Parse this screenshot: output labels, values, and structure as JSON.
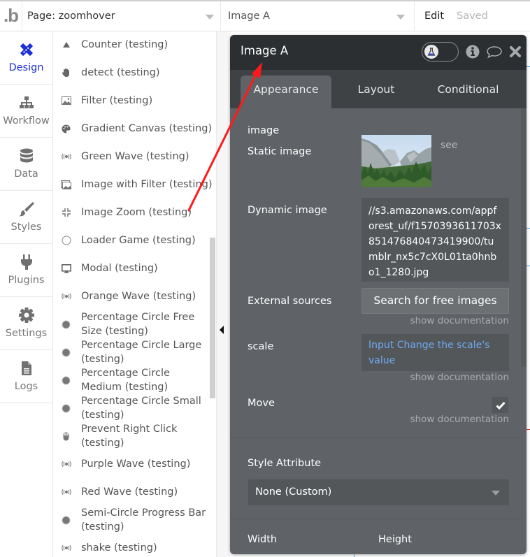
{
  "topbar": {
    "logo": ".b",
    "page_select": "Page: zoomhover",
    "element_select": "Image A",
    "edit_label": "Edit",
    "saved_label": "Saved"
  },
  "leftnav": {
    "items": [
      {
        "label": "Design",
        "icon": "design-icon",
        "active": true
      },
      {
        "label": "Workflow",
        "icon": "workflow-icon"
      },
      {
        "label": "Data",
        "icon": "database-icon"
      },
      {
        "label": "Styles",
        "icon": "brush-icon"
      },
      {
        "label": "Plugins",
        "icon": "plug-icon"
      },
      {
        "label": "Settings",
        "icon": "gear-icon"
      },
      {
        "label": "Logs",
        "icon": "document-icon"
      }
    ],
    "active_color": "#1c2fd6"
  },
  "element_list": {
    "items": [
      {
        "label": "Counter (testing)",
        "icon": "triangle-up-icon"
      },
      {
        "label": "detect (testing)",
        "icon": "hand-icon"
      },
      {
        "label": "Filter (testing)",
        "icon": "picture-icon"
      },
      {
        "label": "Gradient Canvas (testing)",
        "icon": "palette-icon"
      },
      {
        "label": "Green Wave (testing)",
        "icon": "broadcast-icon"
      },
      {
        "label": "Image with Filter (testing)",
        "icon": "pictures-icon"
      },
      {
        "label": "Image Zoom (testing)",
        "icon": "compress-icon"
      },
      {
        "label": "Loader Game (testing)",
        "icon": "circle-outline-icon"
      },
      {
        "label": "Modal (testing)",
        "icon": "monitor-icon"
      },
      {
        "label": "Orange Wave (testing)",
        "icon": "broadcast-icon"
      },
      {
        "label": "Percentage Circle Free Size (testing)",
        "icon": "circle-filled-icon"
      },
      {
        "label": "Percentage Circle Large (testing)",
        "icon": "circle-filled-icon"
      },
      {
        "label": "Percentage Circle Medium (testing)",
        "icon": "circle-filled-icon"
      },
      {
        "label": "Percentage Circle Small (testing)",
        "icon": "circle-filled-icon"
      },
      {
        "label": "Prevent Right Click (testing)",
        "icon": "mouse-icon"
      },
      {
        "label": "Purple Wave (testing)",
        "icon": "broadcast-icon"
      },
      {
        "label": "Red Wave (testing)",
        "icon": "broadcast-icon"
      },
      {
        "label": "Semi-Circle Progress Bar (testing)",
        "icon": "circle-filled-icon"
      },
      {
        "label": "shake (testing)",
        "icon": "broadcast-icon"
      }
    ]
  },
  "editor": {
    "title": "Image A",
    "header_icons": [
      "flask-icon",
      "info-icon",
      "comment-icon",
      "close-icon"
    ],
    "tabs": [
      {
        "label": "Appearance",
        "active": true
      },
      {
        "label": "Layout"
      },
      {
        "label": "Conditional"
      }
    ],
    "section_label": "image",
    "static_image_label": "Static image",
    "see_link": "see",
    "dynamic_image_label": "Dynamic image",
    "dynamic_image_value": "//s3.amazonaws.com/appforest_uf/f1570393611703x851476840473419900/tumblr_nx5c7cX0L01ta0hnbo1_1280.jpg",
    "external_sources_label": "External sources",
    "search_button": "Search for free images",
    "show_documentation": "show documentation",
    "scale_label": "scale",
    "scale_value": "Input Change the scale's value",
    "move_label": "Move",
    "move_checked": true,
    "style_attribute_label": "Style Attribute",
    "style_attribute_value": "None (Custom)",
    "width_label": "Width",
    "height_label": "Height",
    "link_color": "#6eaaf2"
  },
  "annotation": {
    "type": "arrow",
    "color": "#ff1a1a"
  }
}
